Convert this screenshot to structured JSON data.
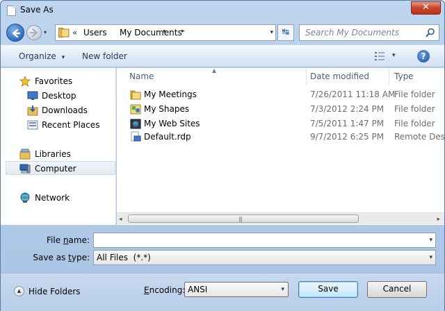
{
  "window": {
    "title": "Save As"
  },
  "nav": {
    "history_arrow": "▾",
    "address": {
      "overflow": "«",
      "crumbs": [
        "Users",
        "My Documents"
      ],
      "separator": "▸",
      "dropdown": "▾"
    },
    "refresh_glyph": "↹",
    "search": {
      "placeholder": "Search My Documents"
    }
  },
  "toolbar": {
    "organize": "Organize",
    "organize_arrow": "▾",
    "new_folder": "New folder",
    "view_arrow": "▾",
    "help": "?"
  },
  "sidebar": {
    "items": [
      {
        "label": "Favorites",
        "icon": "star-icon"
      },
      {
        "label": "Desktop",
        "icon": "desktop-icon"
      },
      {
        "label": "Downloads",
        "icon": "downloads-icon"
      },
      {
        "label": "Recent Places",
        "icon": "recent-places-icon"
      },
      {
        "label": "Libraries",
        "icon": "libraries-icon"
      },
      {
        "label": "Computer",
        "icon": "computer-icon",
        "selected": true
      },
      {
        "label": "Network",
        "icon": "network-icon"
      }
    ]
  },
  "files": {
    "columns": {
      "name": "Name",
      "date": "Date modified",
      "type": "Type",
      "sort_indicator": "▲"
    },
    "rows": [
      {
        "name": "My Meetings",
        "date": "7/26/2011 11:18 AM",
        "type": "File folder",
        "icon": "folder-icon"
      },
      {
        "name": "My Shapes",
        "date": "7/3/2012 2:24 PM",
        "type": "File folder",
        "icon": "shapes-folder-icon"
      },
      {
        "name": "My Web Sites",
        "date": "7/5/2011 1:47 PM",
        "type": "File folder",
        "icon": "web-sites-folder-icon"
      },
      {
        "name": "Default.rdp",
        "date": "9/7/2012 6:25 PM",
        "type": "Remote Desk",
        "icon": "rdp-file-icon"
      }
    ],
    "scroll": {
      "left": "◂",
      "right": "▸",
      "grip": "|||"
    }
  },
  "form": {
    "file_name": {
      "label_prefix": "File ",
      "label_key": "n",
      "label_rest": "ame:",
      "value": "",
      "dropdown": "▾"
    },
    "save_as_type": {
      "label_prefix": "Save as ",
      "label_key": "t",
      "label_rest": "ype:",
      "value": "All Files  (*.*)",
      "dropdown": "▾"
    }
  },
  "footer": {
    "hide_folders": "Hide Folders",
    "hide_glyph": "▲",
    "encoding": {
      "label_key": "E",
      "label_rest": "ncoding:",
      "value": "ANSI",
      "dropdown": "▾"
    },
    "save": "Save",
    "cancel": "Cancel"
  },
  "colors": {
    "accent": "#2d6cc0",
    "close": "#c9432a",
    "folder": "#e8c15a"
  }
}
